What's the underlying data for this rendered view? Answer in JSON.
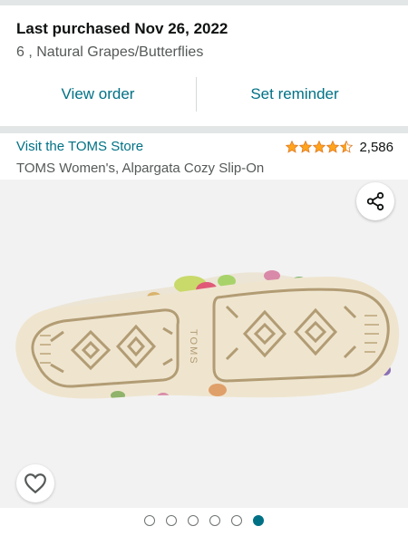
{
  "purchase": {
    "title": "Last purchased Nov 26, 2022",
    "variant": "6 , Natural Grapes/Butterflies"
  },
  "actions": {
    "view_order": "View order",
    "set_reminder": "Set reminder"
  },
  "product": {
    "store_link": "Visit the TOMS Store",
    "rating_stars": 4.5,
    "rating_count": "2,586",
    "title": "TOMS Women's, Alpargata Cozy Slip-On",
    "sole_brand_text": "TOMS"
  },
  "gallery": {
    "image_count": 6,
    "active_index": 5
  },
  "icons": {
    "share": "share-icon",
    "wishlist": "heart-icon",
    "star": "star-icon"
  },
  "colors": {
    "link": "#007185",
    "star": "#ffa41c",
    "text": "#0f1111",
    "secondary_text": "#565959"
  }
}
